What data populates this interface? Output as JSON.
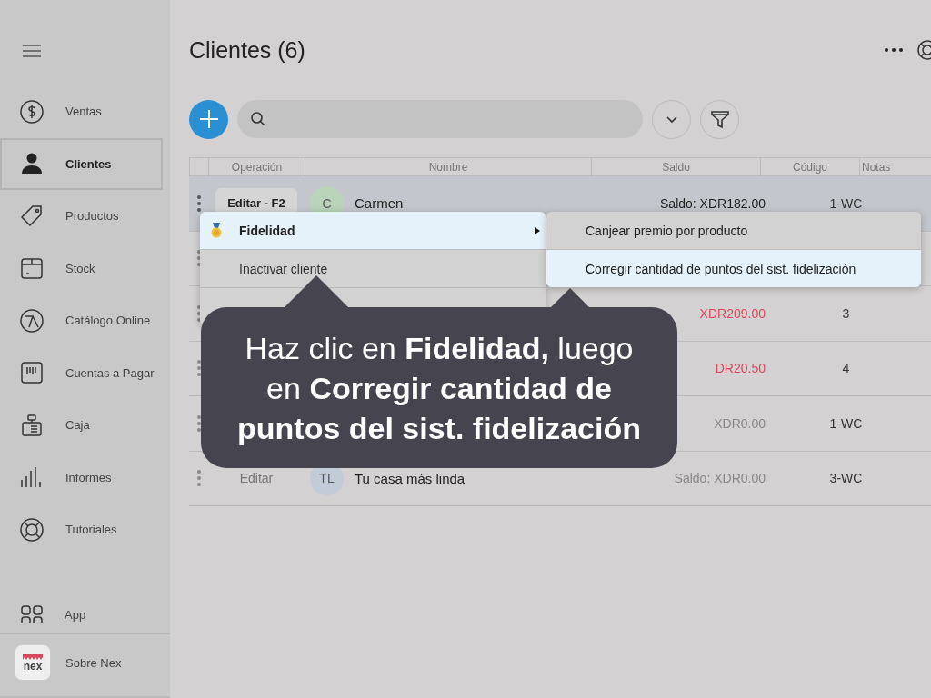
{
  "sidebar": {
    "items": [
      {
        "label": "Ventas",
        "selected": false
      },
      {
        "label": "Clientes",
        "selected": true
      },
      {
        "label": "Productos",
        "selected": false
      },
      {
        "label": "Stock",
        "selected": false
      },
      {
        "label": "Catálogo Online",
        "selected": false
      },
      {
        "label": "Cuentas a Pagar",
        "selected": false
      },
      {
        "label": "Caja",
        "selected": false
      },
      {
        "label": "Informes",
        "selected": false
      },
      {
        "label": "Tutoriales",
        "selected": false
      }
    ],
    "footer": [
      {
        "label": "App"
      },
      {
        "label": "Sobre Nex",
        "logo_text": "nex"
      }
    ]
  },
  "header": {
    "title": "Clientes (6)"
  },
  "table": {
    "columns": [
      "Operación",
      "Nombre",
      "Saldo",
      "Código",
      "Notas"
    ],
    "rows": [
      {
        "selected": true,
        "kind": "normal",
        "action": "Editar - F2",
        "initials": "C",
        "color": "#b9d4b9",
        "name": "Carmen",
        "balance": "Saldo: XDR182.00",
        "code": "1-WC"
      },
      {
        "selected": false
      },
      {
        "selected": false,
        "kind": "debt",
        "balance": "XDR209.00",
        "code": "3"
      },
      {
        "selected": false,
        "kind": "debt",
        "balance": "DR20.50",
        "code": "4"
      },
      {
        "selected": false,
        "kind": "zero",
        "balance": "XDR0.00",
        "code": "1-WC"
      },
      {
        "selected": false,
        "kind": "zero",
        "action": "Editar",
        "initials": "TL",
        "color": "#c3cad8",
        "name": "Tu casa más linda",
        "balance": "Saldo: XDR0.00",
        "code": "3-WC"
      }
    ]
  },
  "context_menu": {
    "items": [
      {
        "label": "Fidelidad",
        "kind": "medal",
        "submenu": true,
        "selected": true
      },
      {
        "label": "Inactivar cliente",
        "kind": "plain",
        "submenu": false,
        "selected": false
      }
    ]
  },
  "submenu": {
    "items": [
      {
        "label": "Canjear premio por producto",
        "selected": false
      },
      {
        "label": "Corregir cantidad de puntos del sist. fidelización",
        "selected": true
      }
    ]
  },
  "callout": {
    "text": "Haz clic en **Fidelidad,** luego en **Corregir cantidad de puntos del sist. fidelización**"
  }
}
